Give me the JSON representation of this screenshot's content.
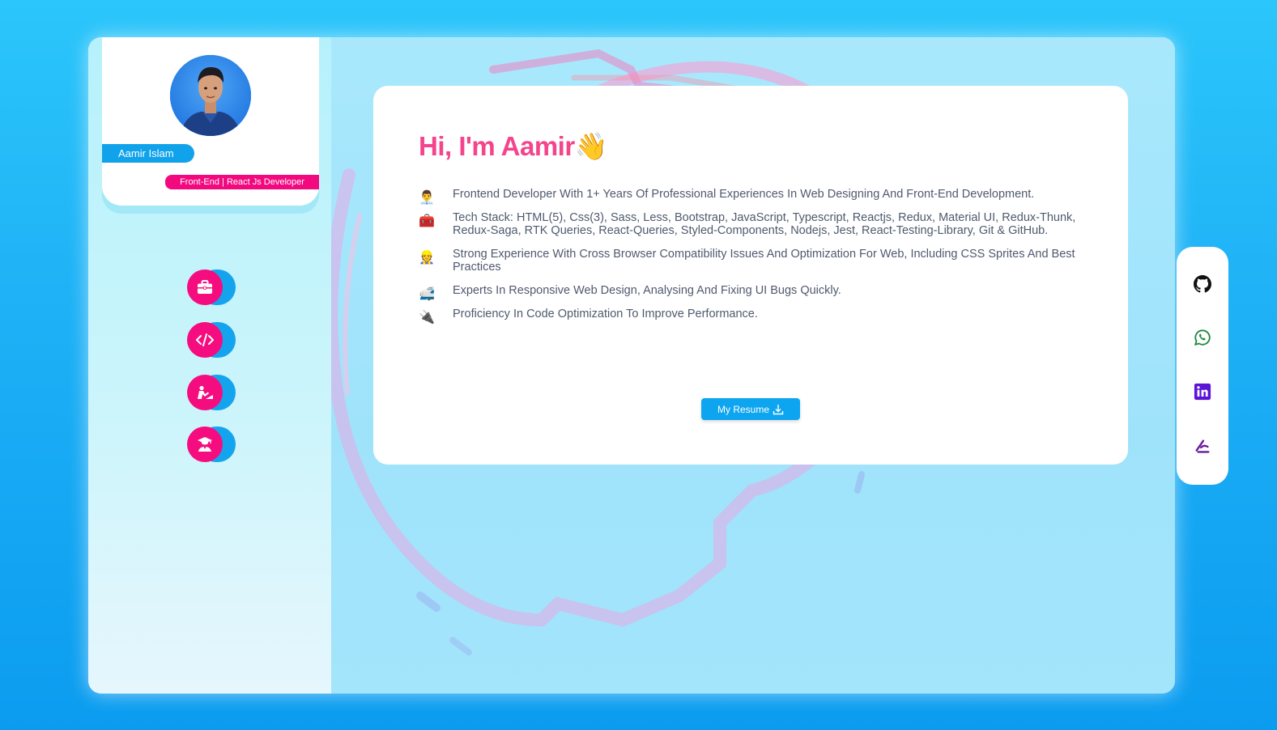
{
  "profile": {
    "name": "Aamir Islam",
    "role": "Front-End | React Js Developer"
  },
  "nav": [
    {
      "icon": "briefcase-icon",
      "label": "Experience"
    },
    {
      "icon": "code-icon",
      "label": "Skills"
    },
    {
      "icon": "projects-icon",
      "label": "Projects"
    },
    {
      "icon": "graduate-icon",
      "label": "Education"
    }
  ],
  "hero": {
    "greeting": "Hi, I'm Aamir",
    "wave": "👋",
    "bullets": [
      {
        "icon": "👨‍💼",
        "text": "Frontend Developer With 1+ Years Of Professional Experiences In Web Designing And Front-End Development."
      },
      {
        "icon": "🧰",
        "text": "Tech Stack: HTML(5), Css(3), Sass, Less, Bootstrap, JavaScript, Typescript, Reactjs, Redux, Material UI, Redux-Thunk, Redux-Saga, RTK Queries, React-Queries, Styled-Components, Nodejs, Jest, React-Testing-Library, Git & GitHub."
      },
      {
        "icon": "👷",
        "text": "Strong Experience With Cross Browser Compatibility Issues And Optimization For Web, Including CSS Sprites And Best Practices"
      },
      {
        "icon": "🚅",
        "text": "Experts In Responsive Web Design, Analysing And Fixing UI Bugs Quickly."
      },
      {
        "icon": "🔌",
        "text": "Proficiency In Code Optimization To Improve Performance."
      }
    ],
    "resume_label": "My Resume"
  },
  "social": [
    {
      "icon": "github-icon",
      "color": "#111111"
    },
    {
      "icon": "whatsapp-icon",
      "color": "#1f8a3c"
    },
    {
      "icon": "linkedin-icon",
      "color": "#5b14d6"
    },
    {
      "icon": "hashnode-icon",
      "color": "#6a1a9a"
    }
  ],
  "colors": {
    "accent_pink": "#f4448c",
    "badge_pink": "#f2097f",
    "accent_blue": "#0ea5f0"
  }
}
